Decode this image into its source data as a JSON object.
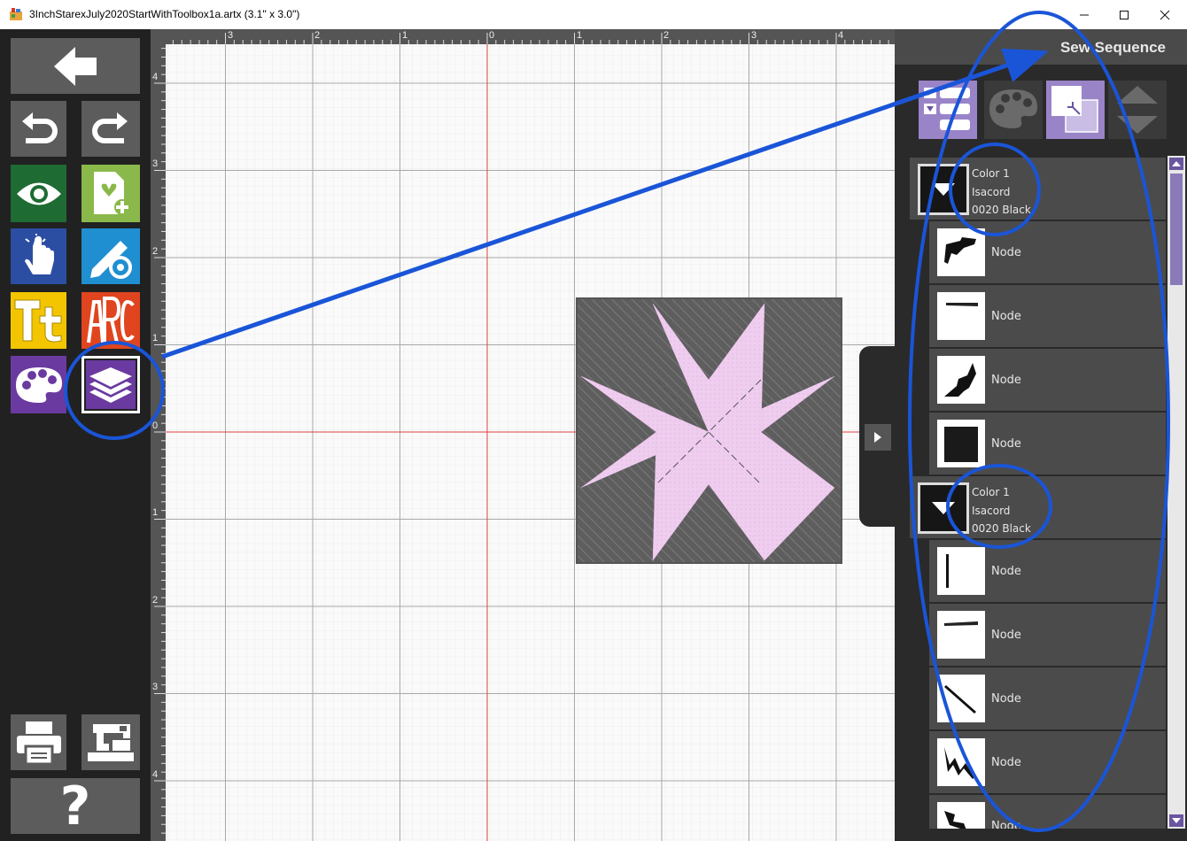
{
  "window": {
    "title": "3InchStarexJuly2020StartWithToolbox1a.artx (3.1\" x 3.0\")",
    "controls": [
      "minimize",
      "maximize",
      "close"
    ]
  },
  "toolbar": {
    "buttons": [
      {
        "name": "back",
        "icon": "arrow-left-icon"
      },
      {
        "name": "undo",
        "icon": "undo-icon"
      },
      {
        "name": "redo",
        "icon": "redo-icon"
      },
      {
        "name": "preview",
        "icon": "eye-icon",
        "color": "#1e6b34"
      },
      {
        "name": "add-design",
        "icon": "add-document-icon",
        "color": "#8ab84a"
      },
      {
        "name": "select",
        "icon": "pointer-hand-icon",
        "color": "#2b4ea3"
      },
      {
        "name": "edit-settings",
        "icon": "pencil-gear-icon",
        "color": "#1f8fd1"
      },
      {
        "name": "text",
        "icon": "text-tt-icon",
        "label": "Tt",
        "color": "#f2c500"
      },
      {
        "name": "monogram",
        "icon": "monogram-icon",
        "label": "ARC",
        "color": "#e0451f"
      },
      {
        "name": "colors",
        "icon": "palette-icon",
        "color": "#6a3aa0"
      },
      {
        "name": "sew-sequence",
        "icon": "layers-icon",
        "color": "#6a3aa0"
      },
      {
        "name": "print",
        "icon": "printer-icon"
      },
      {
        "name": "send-to-machine",
        "icon": "sewing-machine-icon"
      },
      {
        "name": "help",
        "icon": "question-icon",
        "label": "?"
      }
    ]
  },
  "ruler": {
    "top_labels": [
      "3",
      "2",
      "1",
      "0",
      "1",
      "2",
      "3",
      "4"
    ],
    "left_labels": [
      "4",
      "3",
      "2",
      "1",
      "0",
      "1",
      "2",
      "3",
      "4"
    ]
  },
  "canvas": {
    "grid_color": "#d8d8d8",
    "axis_color": "#e04040",
    "design_bg_color": "#666666",
    "star_color": "#ecc9ec"
  },
  "side_panel": {
    "collapse_icon": "chevron-right-icon",
    "title": "Sew Sequence",
    "tools": [
      {
        "name": "list-view",
        "icon": "list-view-icon"
      },
      {
        "name": "color-sort",
        "icon": "palette-icon"
      },
      {
        "name": "layer-order",
        "icon": "layer-order-icon"
      },
      {
        "name": "move-up-down",
        "icon": "up-down-arrows-icon"
      }
    ],
    "groups": [
      {
        "color_label": "Color 1",
        "thread_brand": "Isacord",
        "thread_name": "0020 Black",
        "nodes": [
          "Node",
          "Node",
          "Node",
          "Node"
        ]
      },
      {
        "color_label": "Color 1",
        "thread_brand": "Isacord",
        "thread_name": "0020 Black",
        "nodes": [
          "Node",
          "Node",
          "Node",
          "Node",
          "Node"
        ]
      }
    ]
  },
  "annotation": {
    "color": "#1a55d8"
  }
}
